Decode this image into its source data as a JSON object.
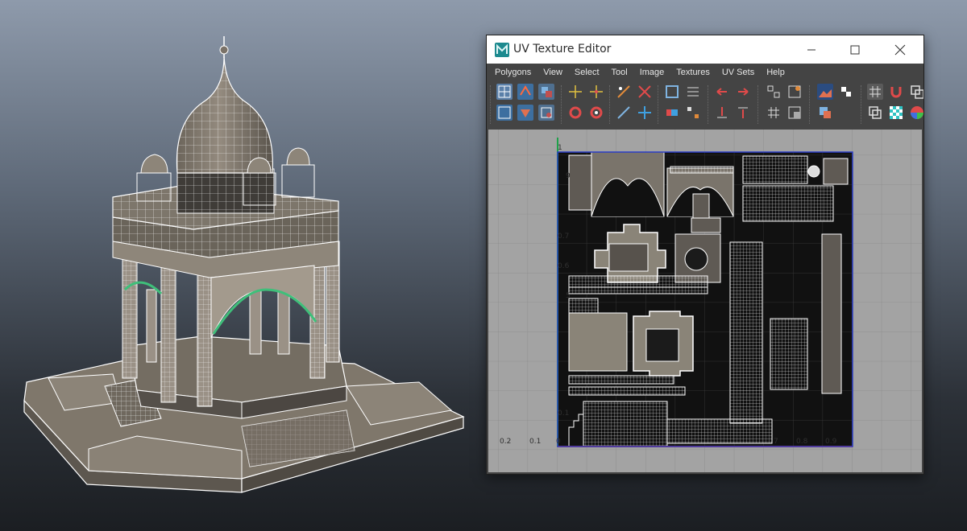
{
  "window": {
    "title": "UV Texture Editor",
    "icon": "maya-app-icon",
    "controls": [
      "minimize-icon",
      "maximize-icon",
      "close-icon"
    ]
  },
  "menu": [
    {
      "label": "Polygons"
    },
    {
      "label": "View"
    },
    {
      "label": "Select"
    },
    {
      "label": "Tool"
    },
    {
      "label": "Image"
    },
    {
      "label": "Textures"
    },
    {
      "label": "UV Sets"
    },
    {
      "label": "Help"
    }
  ],
  "toolbar": {
    "row1": [
      "uv-select-icon",
      "move-uv-icon",
      "uv-paint-icon",
      "move-arrows-icon",
      "move-arrows-icon",
      "snap-uv-icon",
      "cut-uv-icon",
      "flip-uv-icon",
      "layout-uv-icon",
      "arrow-left-icon",
      "arrow-right-icon",
      "grid-select-icon",
      "shell-select-icon",
      "texture-image-icon",
      "checker-icon",
      "grid-toggle-icon",
      "magnet-icon",
      "overlap-icon"
    ],
    "row2": [
      "uv-frame-icon",
      "unfold-icon",
      "relax-icon",
      "rotate-ccw-icon",
      "rotate-cw-icon",
      "align-uv-icon",
      "sew-uv-icon",
      "stack-uv-icon",
      "normalize-icon",
      "arrow-down-icon",
      "arrow-up-icon",
      "grid-snap-icon",
      "shell-snap-icon",
      "image-range-icon",
      "display-wire-icon",
      "checker-map-icon",
      "color-wheel-icon"
    ]
  },
  "uv_canvas": {
    "x_ticks": [
      "0.2",
      "0.1",
      "0",
      "7",
      "0.8",
      "0.9"
    ],
    "y_ticks": [
      "1",
      "9",
      "0.7",
      "0.6",
      "5",
      "0.1"
    ],
    "colors": {
      "u_axis": "#c0392b",
      "v_axis": "#1fa14a",
      "frame": "#2a3cc4",
      "grid": "#8a8a8a",
      "tile": "#111111",
      "wire": "#ffffff"
    }
  },
  "viewport": {
    "model": "indian-temple-pavilion",
    "colors": {
      "stone": "#8a8276",
      "stone_dark": "#5e5850",
      "wire": "#ffffff",
      "selected_edge": "#3fbf7a"
    }
  }
}
